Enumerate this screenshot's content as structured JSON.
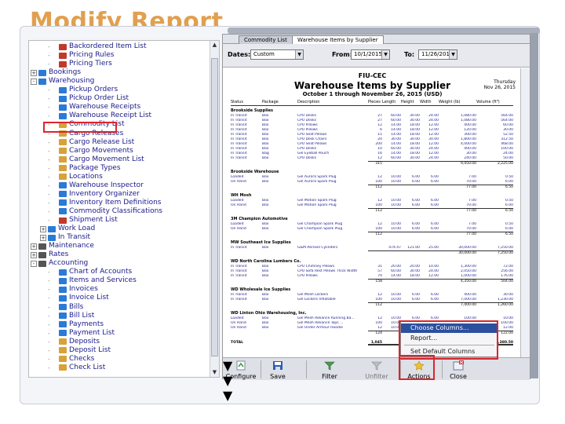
{
  "slide_title": "Modify Report",
  "tree_items": [
    {
      "label": "Backordered Item List",
      "indent": 3,
      "color": "#c0392b"
    },
    {
      "label": "Pricing Rules",
      "indent": 3,
      "color": "#c0392b"
    },
    {
      "label": "Pricing Tiers",
      "indent": 3,
      "color": "#c0392b"
    },
    {
      "label": "Bookings",
      "indent": 1,
      "color": "#2a7bd5",
      "toggle": "+"
    },
    {
      "label": "Warehousing",
      "indent": 1,
      "color": "#2a7bd5",
      "toggle": "-"
    },
    {
      "label": "Pickup Orders",
      "indent": 3,
      "color": "#2a7bd5"
    },
    {
      "label": "Pickup Order List",
      "indent": 3,
      "color": "#2a7bd5"
    },
    {
      "label": "Warehouse Receipts",
      "indent": 3,
      "color": "#2a7bd5"
    },
    {
      "label": "Warehouse Receipt List",
      "indent": 3,
      "color": "#2a7bd5"
    },
    {
      "label": "Commodity List",
      "indent": 3,
      "color": "#d7a23a"
    },
    {
      "label": "Cargo Releases",
      "indent": 3,
      "color": "#d7a23a"
    },
    {
      "label": "Cargo Release List",
      "indent": 3,
      "color": "#d7a23a"
    },
    {
      "label": "Cargo Movements",
      "indent": 3,
      "color": "#d7a23a"
    },
    {
      "label": "Cargo Movement List",
      "indent": 3,
      "color": "#d7a23a"
    },
    {
      "label": "Package Types",
      "indent": 3,
      "color": "#d7a23a"
    },
    {
      "label": "Locations",
      "indent": 3,
      "color": "#d7a23a"
    },
    {
      "label": "Warehouse Inspector",
      "indent": 3,
      "color": "#2a7bd5"
    },
    {
      "label": "Inventory Organizer",
      "indent": 3,
      "color": "#2a7bd5"
    },
    {
      "label": "Inventory Item Definitions",
      "indent": 3,
      "color": "#2a7bd5"
    },
    {
      "label": "Commodity Classifications",
      "indent": 3,
      "color": "#2a7bd5"
    },
    {
      "label": "Shipment List",
      "indent": 3,
      "color": "#c0392b"
    },
    {
      "label": "Work Load",
      "indent": 2,
      "color": "#2a7bd5",
      "toggle": "+"
    },
    {
      "label": "In Transit",
      "indent": 2,
      "color": "#2a7bd5",
      "toggle": "+"
    },
    {
      "label": "Maintenance",
      "indent": 1,
      "color": "#555",
      "toggle": "+"
    },
    {
      "label": "Rates",
      "indent": 1,
      "color": "#555",
      "toggle": "+"
    },
    {
      "label": "Accounting",
      "indent": 1,
      "color": "#555",
      "toggle": "-"
    },
    {
      "label": "Chart of Accounts",
      "indent": 3,
      "color": "#2a7bd5"
    },
    {
      "label": "Items and Services",
      "indent": 3,
      "color": "#2a7bd5"
    },
    {
      "label": "Invoices",
      "indent": 3,
      "color": "#2a7bd5"
    },
    {
      "label": "Invoice List",
      "indent": 3,
      "color": "#2a7bd5"
    },
    {
      "label": "Bills",
      "indent": 3,
      "color": "#2a7bd5"
    },
    {
      "label": "Bill List",
      "indent": 3,
      "color": "#2a7bd5"
    },
    {
      "label": "Payments",
      "indent": 3,
      "color": "#2a7bd5"
    },
    {
      "label": "Payment List",
      "indent": 3,
      "color": "#2a7bd5"
    },
    {
      "label": "Deposits",
      "indent": 3,
      "color": "#d7a23a"
    },
    {
      "label": "Deposit List",
      "indent": 3,
      "color": "#d7a23a"
    },
    {
      "label": "Checks",
      "indent": 3,
      "color": "#d7a23a"
    },
    {
      "label": "Check List",
      "indent": 3,
      "color": "#d7a23a"
    }
  ],
  "tabs": [
    "Commodity List",
    "Warehouse Items by Supplier"
  ],
  "filter": {
    "dates_label": "Dates:",
    "dates_value": "Custom",
    "from_label": "From:",
    "from_value": "10/1/2015",
    "to_label": "To:",
    "to_value": "11/26/2015"
  },
  "report": {
    "company": "FIU-CEC",
    "title": "Warehouse Items by Supplier",
    "subtitle": "October 1 through November 26, 2015 (USD)",
    "time": "Thursday\nNov 26, 2015",
    "columns": [
      "Status",
      "Package",
      "Description",
      "Pieces",
      "Length",
      "Height",
      "Width",
      "Weight (lb)",
      "Volume (ft³)"
    ],
    "groups": [
      {
        "name": "Brookside Supplies",
        "rows": [
          [
            "In Transit",
            "Box",
            "CPU Desks",
            "27",
            "60.00",
            "30.00",
            "24.00",
            "1,080.00",
            "564.00"
          ],
          [
            "In Transit",
            "Box",
            "CPU Desks",
            "27",
            "60.00",
            "30.00",
            "24.00",
            "1,080.00",
            "564.00"
          ],
          [
            "In Transit",
            "Box",
            "CPU Pillows",
            "12",
            "14.00",
            "18.00",
            "12.00",
            "400.00",
            "60.00"
          ],
          [
            "In Transit",
            "Box",
            "CPU Pillows",
            "6",
            "14.00",
            "18.00",
            "12.00",
            "120.00",
            "30.00"
          ],
          [
            "In Transit",
            "Box",
            "CPU Seat Pillows",
            "15",
            "14.00",
            "18.00",
            "12.00",
            "300.00",
            "52.50"
          ],
          [
            "In Transit",
            "Box",
            "CPU Desk Chairs",
            "20",
            "30.00",
            "30.00",
            "30.00",
            "1,800.00",
            "312.50"
          ],
          [
            "In Transit",
            "Box",
            "CPU Seat Pillows",
            "200",
            "14.00",
            "18.00",
            "12.00",
            "4,000.00",
            "468.00"
          ],
          [
            "In Transit",
            "Box",
            "CPU Desks",
            "10",
            "60.00",
            "30.00",
            "24.00",
            "400.00",
            "100.00"
          ],
          [
            "In Transit",
            "Bag",
            "Gel Eyeball Pouch",
            "16",
            "14.00",
            "18.00",
            "12.00",
            "30.00",
            "24.00"
          ],
          [
            "In Transit",
            "Box",
            "CPU Desks",
            "12",
            "60.00",
            "30.00",
            "24.00",
            "240.00",
            "50.00"
          ]
        ],
        "total": [
          "",
          "",
          "",
          "315",
          "",
          "",
          "",
          "9,450.00",
          "2,225.00"
        ]
      },
      {
        "name": "Brookside Warehouse",
        "rows": [
          [
            "Loaded",
            "Box",
            "Gel Aurora Spark Plug",
            "12",
            "10.00",
            "6.00",
            "6.00",
            "7.00",
            "0.50"
          ],
          [
            "On Hand",
            "Box",
            "Gel Aurora Spark Plug",
            "100",
            "10.00",
            "6.00",
            "6.00",
            "70.00",
            "6.00"
          ]
        ],
        "total": [
          "",
          "",
          "",
          "112",
          "",
          "",
          "",
          "77.00",
          "6.50"
        ]
      },
      {
        "name": "WH Mosh",
        "rows": [
          [
            "Loaded",
            "Box",
            "Gel Motion Spark Plug",
            "12",
            "10.00",
            "6.00",
            "6.00",
            "7.00",
            "0.50"
          ],
          [
            "On Hand",
            "Box",
            "Gel Motion Spark Plug",
            "100",
            "10.00",
            "6.00",
            "6.00",
            "70.00",
            "6.00"
          ]
        ],
        "total": [
          "",
          "",
          "",
          "112",
          "",
          "",
          "",
          "77.00",
          "6.50"
        ]
      },
      {
        "name": "3M Champion Automotive",
        "rows": [
          [
            "Loaded",
            "Box",
            "Gel Champion Spark Plug",
            "12",
            "10.00",
            "6.00",
            "6.00",
            "7.00",
            "0.50"
          ],
          [
            "On Hand",
            "Box",
            "Gel Champion Spark Plug",
            "100",
            "10.00",
            "6.00",
            "6.00",
            "70.00",
            "6.00"
          ]
        ],
        "total": [
          "",
          "",
          "",
          "112",
          "",
          "",
          "",
          "77.00",
          "6.50"
        ]
      },
      {
        "name": "MW Southeast Ice Supplies",
        "rows": [
          [
            "In Transit",
            "Box",
            "G&M Aerosol Cylinders",
            "",
            "474.47",
            "121.00",
            "25.00",
            "30,000.00",
            "7,250.00"
          ]
        ],
        "total": [
          "",
          "",
          "",
          "",
          "",
          "",
          "",
          "30,000.00",
          "7,250.00"
        ]
      },
      {
        "name": "WD North Carolina Lumbers Co.",
        "rows": [
          [
            "In Transit",
            "Box",
            "CPU Chimney Pillows",
            "31",
            "20.00",
            "20.00",
            "10.00",
            "1,300.00",
            "72.00"
          ],
          [
            "In Transit",
            "Box",
            "CPU Sofa Rest Pillows Thick Width",
            "57",
            "60.00",
            "30.00",
            "24.00",
            "2,050.00",
            "256.00"
          ],
          [
            "In Transit",
            "Box",
            "CPU Pillows",
            "70",
            "14.00",
            "18.00",
            "12.00",
            "1,000.00",
            "176.00"
          ]
        ],
        "total": [
          "",
          "",
          "",
          "158",
          "",
          "",
          "",
          "4,350.00",
          "504.00"
        ]
      },
      {
        "name": "WD Wholesale Ice Supplies",
        "rows": [
          [
            "In Transit",
            "Box",
            "Gel Mesh Lockers",
            "12",
            "10.00",
            "6.00",
            "6.00",
            "400.00",
            "30.00"
          ],
          [
            "In Transit",
            "Box",
            "Gel Lockers Inflatable",
            "100",
            "10.00",
            "6.00",
            "6.00",
            "7,000.00",
            "1,230.00"
          ]
        ],
        "total": [
          "",
          "",
          "",
          "112",
          "",
          "",
          "",
          "7,400.00",
          "1,260.00"
        ]
      },
      {
        "name": "WD Linton Ohio Warehousing, Inc.",
        "rows": [
          [
            "Loaded",
            "Box",
            "Gel Mesh Reliance Running Ba...",
            "12",
            "10.00",
            "6.00",
            "6.00",
            "100.00",
            "10.00"
          ],
          [
            "On Hand",
            "Box",
            "Gel Mesh Reliance Tops ...",
            "100",
            "10.00",
            "6.00",
            "6.00",
            "1,000.00",
            "100.00"
          ],
          [
            "On Hand",
            "Box",
            "Gel Under Armour Hoodie",
            "12",
            "10.00",
            "6.00",
            "6.00",
            "60.00",
            "12.00"
          ]
        ],
        "total": [
          "",
          "",
          "",
          "124",
          "",
          "",
          "",
          "1,160.00",
          "122.00"
        ]
      }
    ],
    "grand_total": [
      "TOTAL",
      "",
      "",
      "1,045",
      "",
      "",
      "",
      "52,591.00",
      "11,380.50"
    ]
  },
  "actions_menu": [
    "Choose Columns...",
    "Report...",
    "Set Default Columns"
  ],
  "toolbar": {
    "configure": "Configure",
    "save": "Save",
    "filter": "Filter",
    "unfilter": "Unfilter",
    "actions": "Actions",
    "close": "Close"
  },
  "colors": {
    "title": "#e0a050",
    "highlight": "#d9262e",
    "menu_selected": "#2c4f9e"
  }
}
